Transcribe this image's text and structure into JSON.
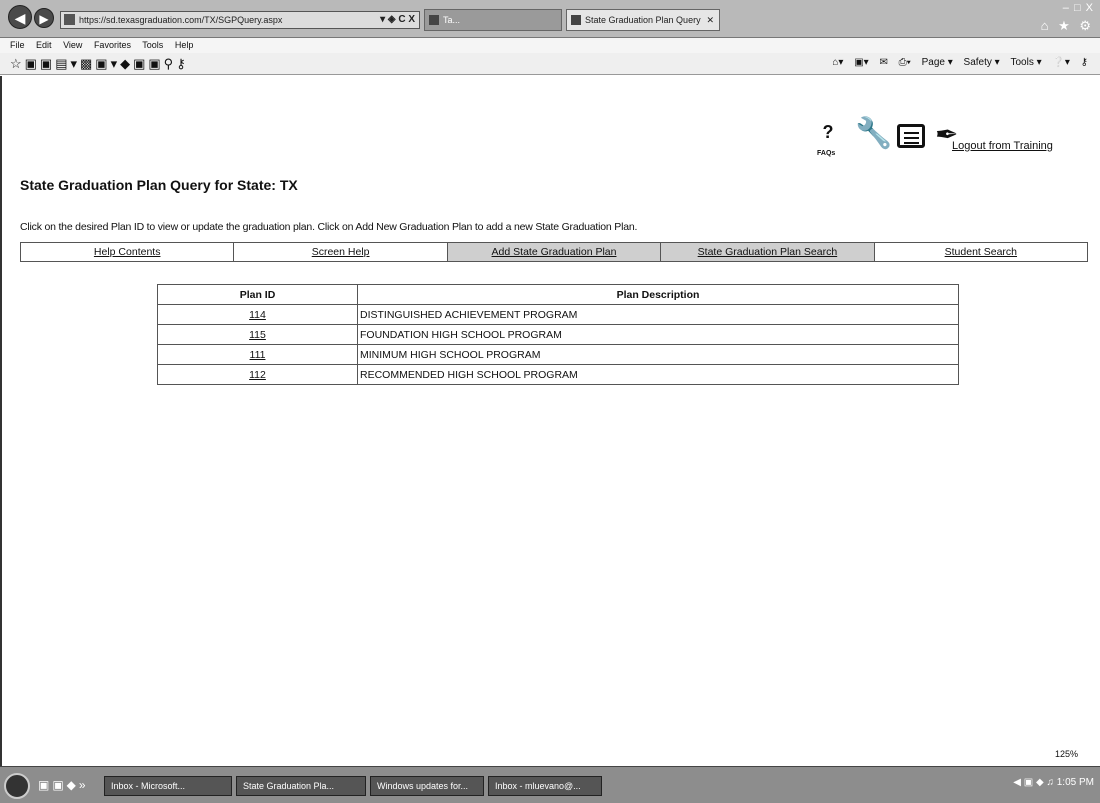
{
  "browser": {
    "address": "https://sd.texasgraduation.com/TX/SGPQuery.aspx",
    "address_controls": "▾ ◈ C X",
    "tabs": [
      {
        "label": "Ta..."
      },
      {
        "label": "State Graduation Plan Query"
      }
    ],
    "window_controls": "– □ X",
    "menu": [
      "File",
      "Edit",
      "View",
      "Favorites",
      "Tools",
      "Help"
    ],
    "command_bar": [
      "Page ▾",
      "Safety ▾",
      "Tools ▾"
    ],
    "zoom": "125%"
  },
  "header": {
    "faqs_label": "FAQs",
    "logout": "Logout from Training"
  },
  "page": {
    "title": "State Graduation Plan Query for State: TX",
    "instructions": "Click on the desired Plan ID to view or update the graduation plan. Click on Add New Graduation Plan to add a new State Graduation Plan.",
    "nav": [
      {
        "label": "Help Contents"
      },
      {
        "label": "Screen Help"
      },
      {
        "label": "Add State Graduation Plan"
      },
      {
        "label": "State Graduation Plan Search"
      },
      {
        "label": "Student Search"
      }
    ]
  },
  "table": {
    "headers": {
      "id": "Plan ID",
      "desc": "Plan Description"
    },
    "rows": [
      {
        "id": "114",
        "desc": "DISTINGUISHED ACHIEVEMENT PROGRAM"
      },
      {
        "id": "115",
        "desc": "FOUNDATION HIGH SCHOOL PROGRAM"
      },
      {
        "id": "111",
        "desc": "MINIMUM HIGH SCHOOL PROGRAM"
      },
      {
        "id": "112",
        "desc": "RECOMMENDED HIGH SCHOOL PROGRAM"
      }
    ]
  },
  "taskbar": {
    "items": [
      {
        "label": "Inbox - Microsoft..."
      },
      {
        "label": "State Graduation Pla..."
      },
      {
        "label": "Windows updates for..."
      },
      {
        "label": "Inbox - mluevano@..."
      }
    ],
    "time": "1:05 PM"
  }
}
